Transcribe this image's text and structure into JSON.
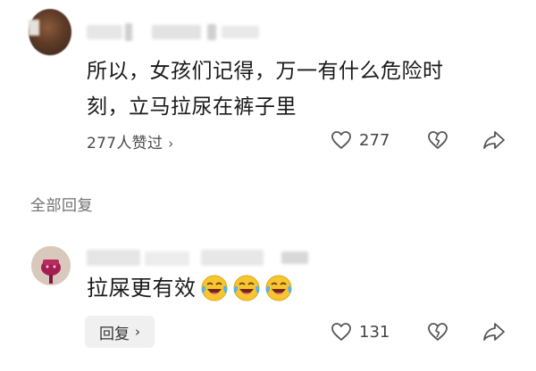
{
  "comment": {
    "text_line1": "所以，女孩们记得，万一有什么危险时",
    "text_line2": "刻，立马拉尿在裤子里",
    "likes_link": "277人赞过",
    "like_count": "277"
  },
  "replies_section": {
    "label": "全部回复"
  },
  "reply": {
    "text": "拉屎更有效",
    "reply_button": "回复",
    "like_count": "131",
    "emoji_count": 3
  },
  "icons": {
    "like": "heart-outline-icon",
    "dislike": "broken-heart-icon",
    "share": "share-arrow-icon",
    "chevron": "chevron-right-icon",
    "emoji": "crying-laughing-emoji"
  },
  "colors": {
    "text_primary": "#1a1a1a",
    "text_secondary": "#707070",
    "icon": "#555555",
    "button_bg": "#f0f0f0"
  }
}
